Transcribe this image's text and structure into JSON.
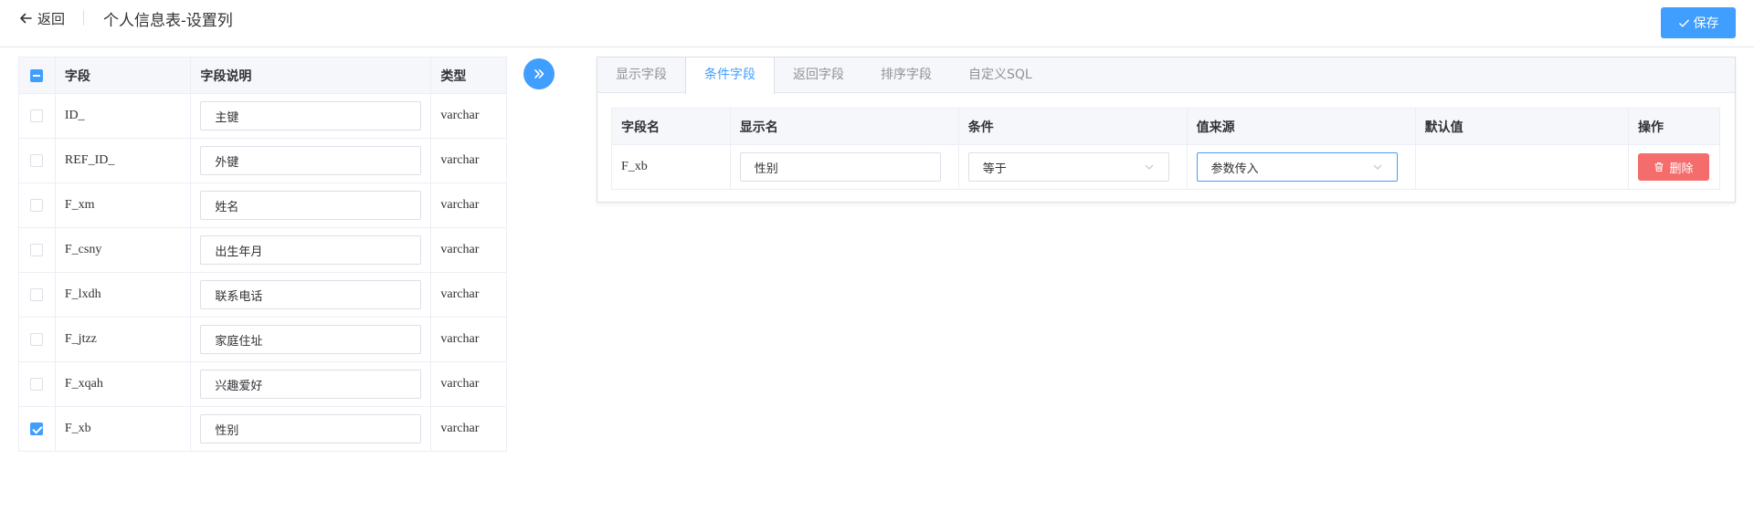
{
  "header": {
    "back_label": "返回",
    "title": "个人信息表-设置列",
    "save_label": "保存"
  },
  "field_table": {
    "headers": [
      "字段",
      "字段说明",
      "类型"
    ],
    "rows": [
      {
        "field": "ID_",
        "desc": "主键",
        "type": "varchar",
        "checked": false
      },
      {
        "field": "REF_ID_",
        "desc": "外键",
        "type": "varchar",
        "checked": false
      },
      {
        "field": "F_xm",
        "desc": "姓名",
        "type": "varchar",
        "checked": false
      },
      {
        "field": "F_csny",
        "desc": "出生年月",
        "type": "varchar",
        "checked": false
      },
      {
        "field": "F_lxdh",
        "desc": "联系电话",
        "type": "varchar",
        "checked": false
      },
      {
        "field": "F_jtzz",
        "desc": "家庭住址",
        "type": "varchar",
        "checked": false
      },
      {
        "field": "F_xqah",
        "desc": "兴趣爱好",
        "type": "varchar",
        "checked": false
      },
      {
        "field": "F_xb",
        "desc": "性别",
        "type": "varchar",
        "checked": true
      }
    ]
  },
  "tabs": [
    {
      "label": "显示字段",
      "active": false
    },
    {
      "label": "条件字段",
      "active": true
    },
    {
      "label": "返回字段",
      "active": false
    },
    {
      "label": "排序字段",
      "active": false
    },
    {
      "label": "自定义SQL",
      "active": false
    }
  ],
  "condition_table": {
    "headers": [
      "字段名",
      "显示名",
      "条件",
      "值来源",
      "默认值",
      "操作"
    ],
    "rows": [
      {
        "field_name": "F_xb",
        "display_name": "性别",
        "condition": "等于",
        "value_source": "参数传入",
        "default_value": "",
        "delete_label": "删除"
      }
    ]
  },
  "colors": {
    "primary": "#409eff",
    "danger": "#f56c6c",
    "header_bg": "#f5f7fa",
    "border": "#ebeef5"
  }
}
